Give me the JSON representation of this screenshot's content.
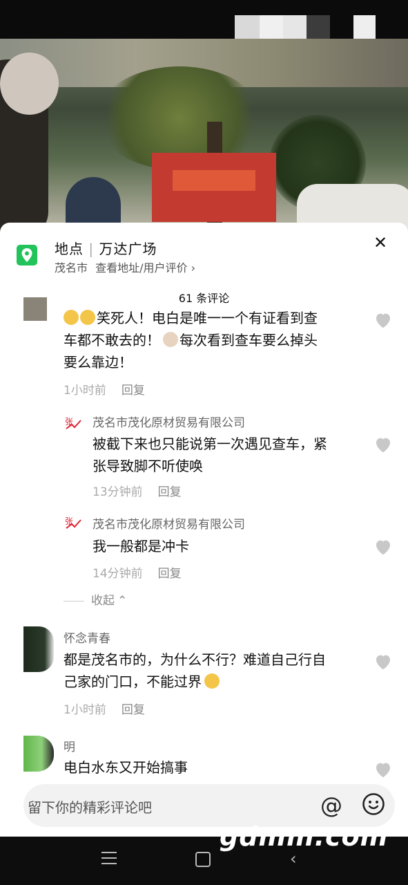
{
  "location": {
    "label": "地点",
    "separator": "|",
    "name": "万达广场",
    "city": "茂名市",
    "detail_link": "查看地址/用户评价",
    "chevron": "›"
  },
  "close_glyph": "✕",
  "comment_count": "61 条评论",
  "comments": [
    {
      "text_line1": "笑死人！电白是唯一一个有证看到查",
      "text_line2": "车都不敢去的！",
      "text_line2b": "每次看到查车要么掉头",
      "text_line3": "要么靠边！",
      "time": "1小时前",
      "reply": "回复"
    },
    {
      "name": "茂名市茂化原材贸易有限公司",
      "text_line1": "被截下来也只能说第一次遇见查车，紧",
      "text_line2": "张导致脚不听使唤",
      "time": "13分钟前",
      "reply": "回复"
    },
    {
      "name": "茂名市茂化原材贸易有限公司",
      "text_line1": "我一般都是冲卡",
      "time": "14分钟前",
      "reply": "回复"
    },
    {
      "name": "怀念青春",
      "text_line1": "都是茂名市的，为什么不行？难道自己行自",
      "text_line2": "己家的门口，不能过界",
      "time": "1小时前",
      "reply": "回复"
    },
    {
      "name": "明",
      "text_line1": "电白水东又开始搞事"
    }
  ],
  "collapse_label": "收起",
  "collapse_chevron": "⌃",
  "input": {
    "placeholder": "留下你的精彩评论吧",
    "at_glyph": "@"
  },
  "watermark": "gdmm.com",
  "colors": {
    "location_icon": "#21c35a",
    "heart": "#c8c8c8"
  },
  "icons": [
    "location-pin-icon",
    "close-icon",
    "heart-icon",
    "at-icon",
    "emoji-icon",
    "menu-icon",
    "home-icon",
    "back-icon"
  ]
}
